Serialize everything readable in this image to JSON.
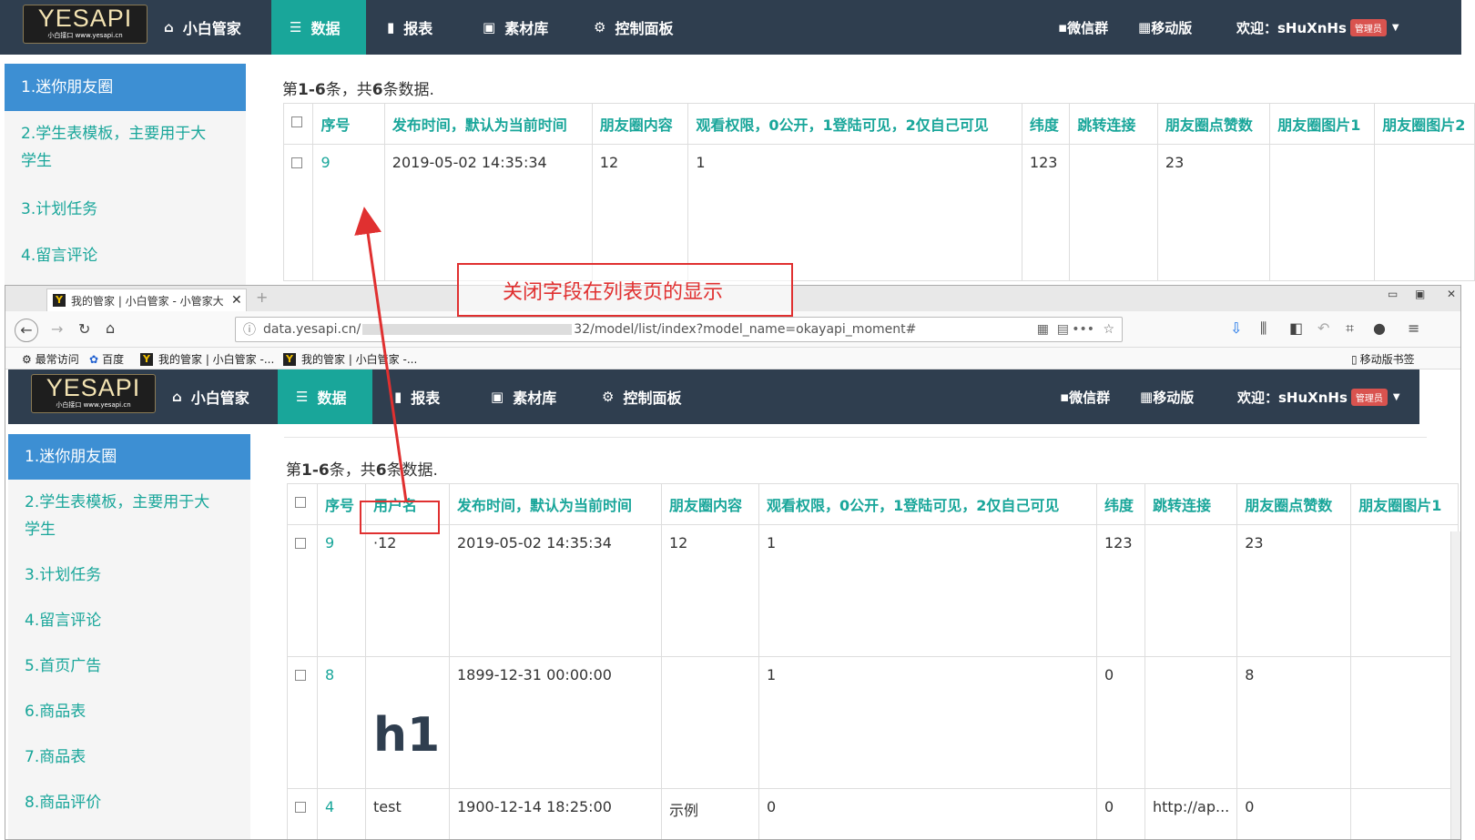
{
  "app": {
    "logo_text": "YESAPI",
    "logo_subtext": "小白接口 www.yesapi.cn",
    "nav": [
      {
        "icon": "home-icon",
        "label": "小白管家"
      },
      {
        "icon": "list-icon",
        "label": "数据"
      },
      {
        "icon": "bar-chart-icon",
        "label": "报表"
      },
      {
        "icon": "image-icon",
        "label": "素材库"
      },
      {
        "icon": "gear-icon",
        "label": "控制面板"
      }
    ],
    "nav_right": {
      "wechat": "微信群",
      "mobile": "移动版",
      "welcome": "欢迎：sHuXnHs",
      "role_badge": "管理员"
    },
    "sidebar": [
      "1.迷你朋友圈",
      "2.学生表模板，主要用于大学生",
      "3.计划任务",
      "4.留言评论",
      "5.首页广告",
      "6.商品表",
      "7.商品表",
      "8.商品评价"
    ],
    "sidebar_top_visible": [
      "1.迷你朋友圈",
      "2.学生表模板，主要用于大学生",
      "3.计划任务",
      "4.留言评论"
    ],
    "summary": {
      "prefix": "第",
      "range": "1-6",
      "mid": "条，共",
      "total": "6",
      "suffix": "条数据."
    }
  },
  "top_table": {
    "headers": [
      "序号",
      "发布时间，默认为当前时间",
      "朋友圈内容",
      "观看权限，0公开，1登陆可见，2仅自己可见",
      "纬度",
      "跳转连接",
      "朋友圈点赞数",
      "朋友圈图片1",
      "朋友圈图片2"
    ],
    "rows": [
      [
        "9",
        "2019-05-02 14:35:34",
        "12",
        "1",
        "123",
        "",
        "23",
        "",
        ""
      ]
    ]
  },
  "browser": {
    "tab_title": "我的管家 | 小白管家 - 小管家大",
    "url_prefix": "data.yesapi.cn/",
    "url_suffix": "32/model/list/index?model_name=okayapi_moment#",
    "bookmarks": [
      "最常访问",
      "百度",
      "我的管家 | 小白管家 -...",
      "我的管家 | 小白管家 -..."
    ],
    "mobile_bookmarks": "移动版书签"
  },
  "callout": {
    "text": "关闭字段在列表页的显示"
  },
  "bottom_table": {
    "headers": [
      "序号",
      "用户名",
      "发布时间，默认为当前时间",
      "朋友圈内容",
      "观看权限，0公开，1登陆可见，2仅自己可见",
      "纬度",
      "跳转连接",
      "朋友圈点赞数",
      "朋友圈图片1"
    ],
    "rows": [
      [
        "9",
        "·12",
        "2019-05-02 14:35:34",
        "12",
        "1",
        "123",
        "",
        "23",
        ""
      ],
      [
        "8",
        "h1",
        "1899-12-31 00:00:00",
        "",
        "1",
        "0",
        "",
        "8",
        ""
      ],
      [
        "4",
        "test",
        "1900-12-14 18:25:00",
        "示例",
        "0",
        "0",
        "http://ap...",
        "0",
        ""
      ]
    ]
  }
}
